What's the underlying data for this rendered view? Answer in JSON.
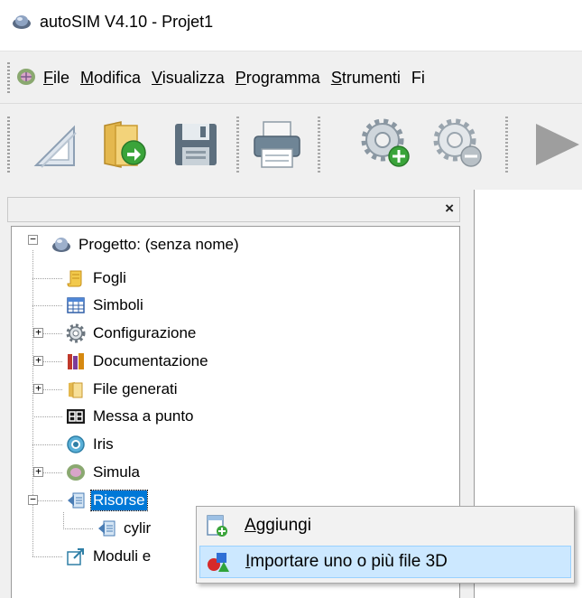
{
  "window": {
    "title": "autoSIM  V4.10 - Projet1"
  },
  "menubar": {
    "items": [
      {
        "label": "File",
        "mnemonic": "F",
        "rest": "ile"
      },
      {
        "label": "Modifica",
        "mnemonic": "M",
        "rest": "odifica"
      },
      {
        "label": "Visualizza",
        "mnemonic": "V",
        "rest": "isualizza"
      },
      {
        "label": "Programma",
        "mnemonic": "P",
        "rest": "rogramma"
      },
      {
        "label": "Strumenti",
        "mnemonic": "S",
        "rest": "trumenti"
      },
      {
        "label": "Fi",
        "mnemonic": "",
        "rest": "Fi"
      }
    ]
  },
  "toolbar": {
    "buttons": [
      {
        "name": "new-sheet",
        "icon": "triangle-ruler-icon"
      },
      {
        "name": "open",
        "icon": "folder-open-icon"
      },
      {
        "name": "save",
        "icon": "floppy-disk-icon"
      },
      {
        "name": "print",
        "icon": "printer-icon"
      },
      {
        "name": "add-config",
        "icon": "gear-add-icon"
      },
      {
        "name": "remove-config",
        "icon": "gear-remove-icon"
      },
      {
        "name": "run",
        "icon": "play-icon"
      }
    ]
  },
  "panel": {
    "close_label": "×"
  },
  "tree": {
    "root": "Progetto: (senza nome)",
    "items": {
      "fogli": "Fogli",
      "simboli": "Simboli",
      "configurazione": "Configurazione",
      "documentazione": "Documentazione",
      "file_generati": "File generati",
      "messa_a_punto": "Messa a punto",
      "iris": "Iris",
      "simula": "Simula",
      "risorse": "Risorse",
      "cylinder": "cylir",
      "moduli": "Moduli e"
    },
    "expander_plus": "+",
    "expander_minus": "−"
  },
  "context_menu": {
    "items": [
      {
        "label": "Aggiungi",
        "first": "A",
        "rest": "ggiungi"
      },
      {
        "label": "Importare uno o più file 3D",
        "first": "I",
        "rest": "mportare uno o più file 3D"
      }
    ]
  },
  "colors": {
    "selection": "#0078d7",
    "menu_hover": "#cce8ff",
    "chrome": "#f0f0f0"
  }
}
